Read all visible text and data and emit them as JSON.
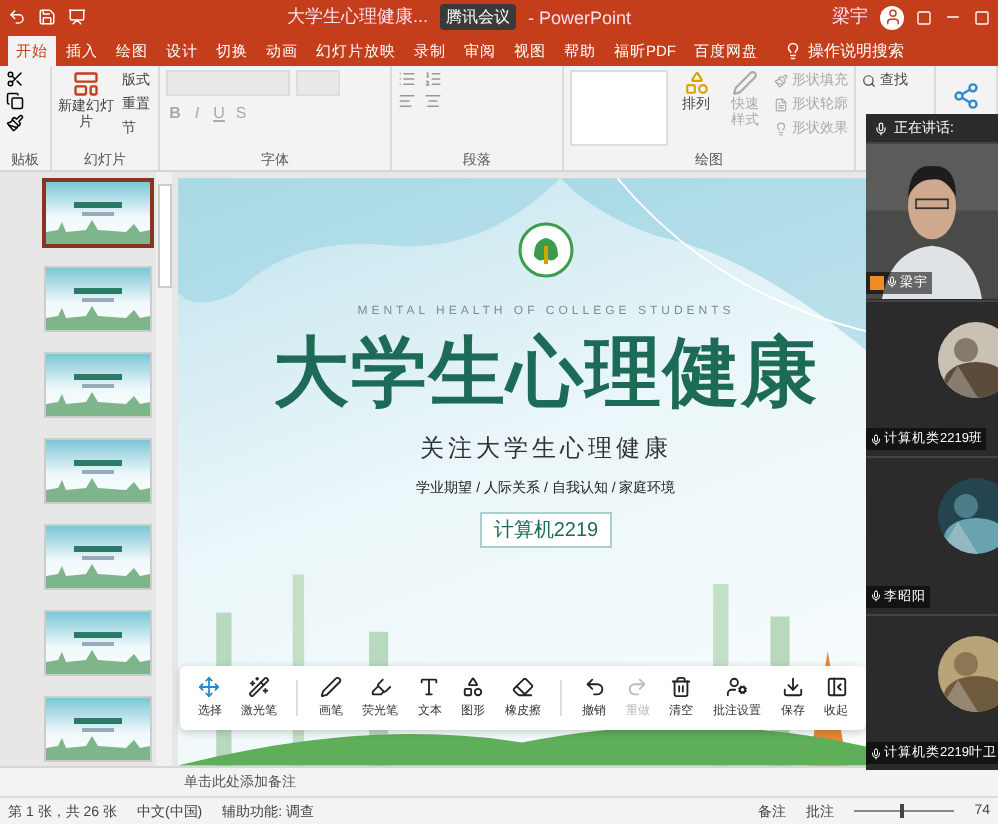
{
  "window": {
    "title": "大学生心理健康...",
    "app": "- PowerPoint",
    "overlay_badge": "腾讯会议",
    "user": "梁宇"
  },
  "tabs": [
    {
      "label": "开始",
      "selected": true
    },
    {
      "label": "插入",
      "selected": false
    },
    {
      "label": "绘图",
      "selected": false
    },
    {
      "label": "设计",
      "selected": false
    },
    {
      "label": "切换",
      "selected": false
    },
    {
      "label": "动画",
      "selected": false
    },
    {
      "label": "幻灯片放映",
      "selected": false
    },
    {
      "label": "录制",
      "selected": false
    },
    {
      "label": "审阅",
      "selected": false
    },
    {
      "label": "视图",
      "selected": false
    },
    {
      "label": "帮助",
      "selected": false
    },
    {
      "label": "福昕PDF",
      "selected": false
    },
    {
      "label": "百度网盘",
      "selected": false
    }
  ],
  "search": {
    "placeholder": "操作说明搜索"
  },
  "ribbon": {
    "clipboard": {
      "label": "贴板"
    },
    "slides": {
      "new_slide": "新建幻灯片",
      "items": [
        "版式",
        "重置",
        "节"
      ],
      "label": "幻灯片"
    },
    "font": {
      "format_buttons": [
        "B",
        "I",
        "U",
        "S"
      ],
      "label": "字体"
    },
    "paragraph": {
      "label": "段落"
    },
    "drawing": {
      "arrange": "排列",
      "quick_styles": "快速样式",
      "shape_items": [
        "形状填充",
        "形状轮廓",
        "形状效果"
      ],
      "label": "绘图"
    },
    "editing": {
      "items": [
        "查找"
      ]
    }
  },
  "thumbnails": [
    {
      "selected": true
    },
    {
      "selected": false
    },
    {
      "selected": false
    },
    {
      "selected": false
    },
    {
      "selected": false
    },
    {
      "selected": false
    },
    {
      "selected": false
    }
  ],
  "slide": {
    "subtitle_en": "MENTAL HEALTH OF COLLEGE STUDENTS",
    "title": "大学生心理健康",
    "tagline": "关注大学生心理健康",
    "topics": "学业期望 / 人际关系 / 自我认知 / 家庭环境",
    "class_label": "计算机2219"
  },
  "toolbar": [
    {
      "label": "选择",
      "disabled": false
    },
    {
      "label": "激光笔",
      "disabled": false
    },
    {
      "label": "画笔",
      "disabled": false
    },
    {
      "label": "荧光笔",
      "disabled": false
    },
    {
      "label": "文本",
      "disabled": false
    },
    {
      "label": "图形",
      "disabled": false
    },
    {
      "label": "橡皮擦",
      "disabled": false
    },
    {
      "label": "撤销",
      "disabled": false
    },
    {
      "label": "重做",
      "disabled": true
    },
    {
      "label": "清空",
      "disabled": false
    },
    {
      "label": "批注设置",
      "disabled": false
    },
    {
      "label": "保存",
      "disabled": false
    },
    {
      "label": "收起",
      "disabled": false
    }
  ],
  "notes": {
    "placeholder": "单击此处添加备注"
  },
  "status_bar": {
    "slide_count": "第 1 张，共 26 张",
    "language": "中文(中国)",
    "accessibility": "辅助功能: 调查",
    "notes": "备注",
    "comments": "批注",
    "zoom": {
      "level": 0.45
    },
    "zoom_percent": "74"
  },
  "meeting": {
    "header": "正在讲话:",
    "participants": [
      {
        "name": "梁宇",
        "kind": "video",
        "host": true
      },
      {
        "name": "计算机类2219班",
        "kind": "avatar",
        "host": false
      },
      {
        "name": "李昭阳",
        "kind": "avatar",
        "host": false
      },
      {
        "name": "计算机类2219叶卫",
        "kind": "avatar",
        "host": false
      }
    ]
  }
}
